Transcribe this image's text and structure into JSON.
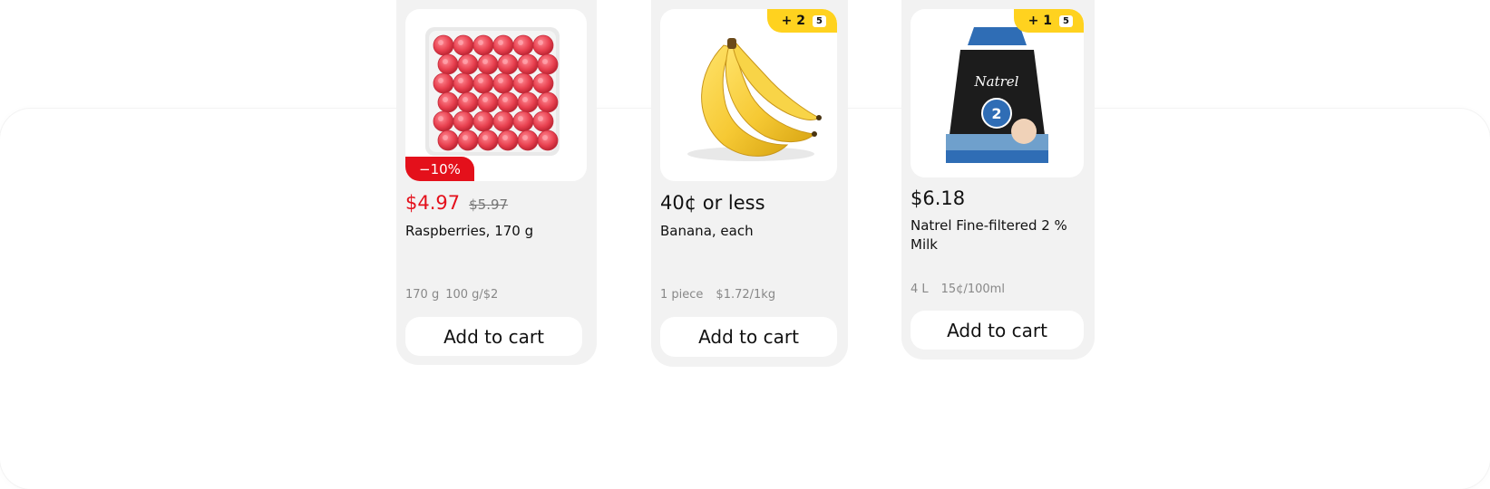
{
  "products": [
    {
      "image_icon": "raspberries-image",
      "discount_badge": "−10%",
      "price": "$4.97",
      "old_price": "$5.97",
      "name": "Raspberries, 170 g",
      "unit_info": [
        "170 g",
        "100 g/$2"
      ],
      "cart_label": "Add to cart"
    },
    {
      "image_icon": "banana-image",
      "promo_badge": "+ 2",
      "promo_icon_text": "5",
      "price": "40¢ or less",
      "name": "Banana, each",
      "unit_info": [
        "1 piece",
        "$1.72/1kg"
      ],
      "cart_label": "Add to cart"
    },
    {
      "image_icon": "milk-bag-image",
      "promo_badge": "+ 1",
      "promo_icon_text": "5",
      "brand_text": "Natrel",
      "price": "$6.18",
      "name": "Natrel Fine-filtered 2 % Milk",
      "unit_info": [
        "4 L",
        "15¢/100ml"
      ],
      "cart_label": "Add to cart"
    }
  ],
  "colors": {
    "sale_red": "#e4101b",
    "promo_yellow": "#ffd21f",
    "card_bg": "#f2f2f2"
  }
}
